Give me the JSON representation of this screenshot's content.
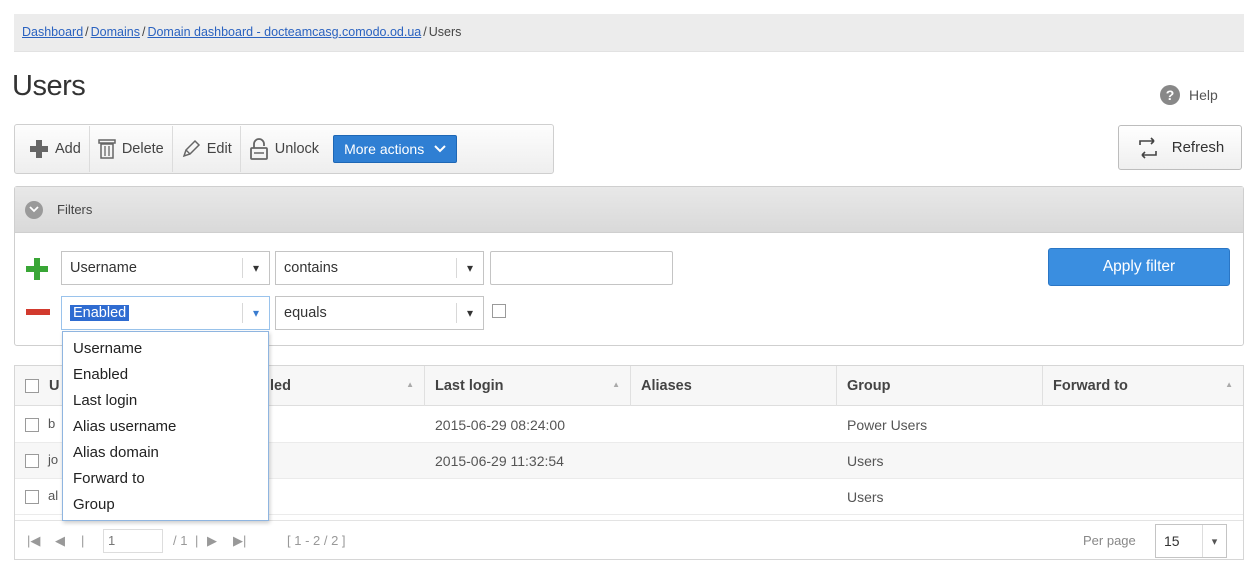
{
  "breadcrumb": {
    "items": [
      "Dashboard",
      "Domains",
      "Domain dashboard - docteamcasg.comodo.od.ua"
    ],
    "current": "Users",
    "separator": "/"
  },
  "page": {
    "title": "Users",
    "help_label": "Help",
    "help_icon_glyph": "?"
  },
  "toolbar": {
    "add_label": "Add",
    "delete_label": "Delete",
    "edit_label": "Edit",
    "unlock_label": "Unlock",
    "more_actions_label": "More actions",
    "refresh_label": "Refresh"
  },
  "filters": {
    "title": "Filters",
    "apply_label": "Apply filter",
    "rows": [
      {
        "field": "Username",
        "operator": "contains",
        "value": ""
      },
      {
        "field": "Enabled",
        "operator": "equals",
        "checked": false
      }
    ],
    "field_options": [
      "Username",
      "Enabled",
      "Last login",
      "Alias username",
      "Alias domain",
      "Forward to",
      "Group"
    ]
  },
  "grid": {
    "columns": [
      "U",
      "led",
      "Last login",
      "Aliases",
      "Group",
      "Forward to"
    ],
    "rows": [
      {
        "username_partial": "b",
        "last_login": "2015-06-29 08:24:00",
        "aliases": "",
        "group": "Power Users",
        "forward_to": ""
      },
      {
        "username_partial": "jo",
        "last_login": "2015-06-29 11:32:54",
        "aliases": "",
        "group": "Users",
        "forward_to": ""
      },
      {
        "username_partial": "al",
        "last_login": "",
        "aliases": "",
        "group": "Users",
        "forward_to": ""
      }
    ]
  },
  "pager": {
    "page": "1",
    "total_pages": "/ 1",
    "range": "[ 1 - 2 / 2 ]",
    "per_page_label": "Per page",
    "per_page_value": "15",
    "first_glyph": "|◀",
    "prev_glyph": "◀",
    "next_glyph": "▶",
    "last_glyph": "▶|",
    "divider_glyph": "|"
  },
  "colors": {
    "accent": "#2f7fd3",
    "link": "#2a62c0",
    "add_green": "#39a636",
    "remove_red": "#d23a2e"
  }
}
